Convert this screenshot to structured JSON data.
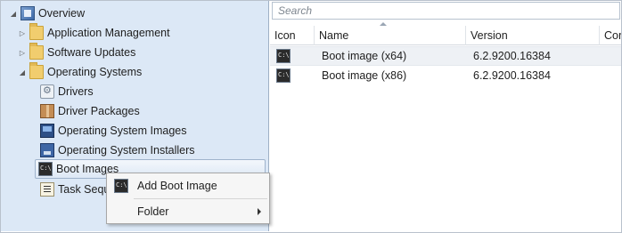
{
  "tree": {
    "root": {
      "label": "Overview",
      "icon": "overview-icon"
    },
    "items": [
      {
        "label": "Application Management",
        "icon": "folder-icon"
      },
      {
        "label": "Software Updates",
        "icon": "folder-icon"
      },
      {
        "label": "Operating Systems",
        "icon": "folder-icon"
      },
      {
        "label": "Drivers",
        "icon": "driver-icon"
      },
      {
        "label": "Driver Packages",
        "icon": "driver-package-icon"
      },
      {
        "label": "Operating System Images",
        "icon": "os-image-icon"
      },
      {
        "label": "Operating System Installers",
        "icon": "os-installer-icon"
      },
      {
        "label": "Boot Images",
        "icon": "boot-image-icon"
      },
      {
        "label": "Task Seque",
        "icon": "task-sequence-icon"
      }
    ]
  },
  "search": {
    "placeholder": "Search"
  },
  "table": {
    "columns": [
      "Icon",
      "Name",
      "Version",
      "Cor"
    ],
    "rows": [
      {
        "name": "Boot image (x64)",
        "version": "6.2.9200.16384"
      },
      {
        "name": "Boot image (x86)",
        "version": "6.2.9200.16384"
      }
    ]
  },
  "context_menu": {
    "items": [
      {
        "label": "Add Boot Image",
        "icon": "boot-image-icon"
      },
      {
        "label": "Folder",
        "has_submenu": true
      }
    ]
  }
}
